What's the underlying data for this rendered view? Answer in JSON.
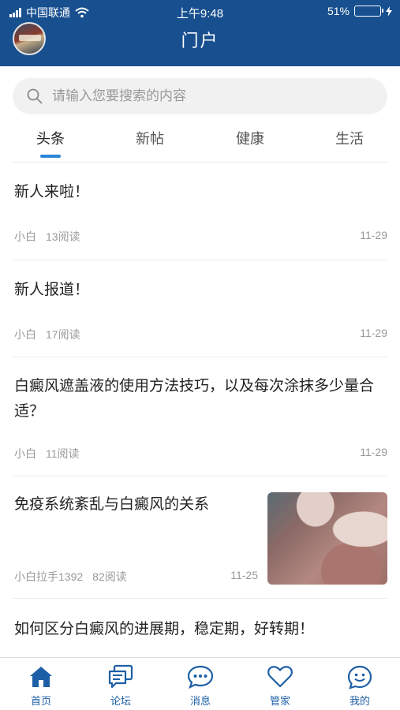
{
  "status_bar": {
    "carrier": "中国联通",
    "time": "上午9:48",
    "battery": "51%",
    "battery_level": 0.51
  },
  "header": {
    "title": "门户"
  },
  "search": {
    "placeholder": "请输入您要搜索的内容"
  },
  "tabs": [
    {
      "label": "头条",
      "active": true
    },
    {
      "label": "新帖",
      "active": false
    },
    {
      "label": "健康",
      "active": false
    },
    {
      "label": "生活",
      "active": false
    }
  ],
  "articles": [
    {
      "title": "新人来啦！",
      "author": "小白",
      "reads": "13阅读",
      "date": "11-29"
    },
    {
      "title": "新人报道！",
      "author": "小白",
      "reads": "17阅读",
      "date": "11-29"
    },
    {
      "title": "白癜风遮盖液的使用方法技巧，以及每次涂抹多少量合适？",
      "author": "小白",
      "reads": "11阅读",
      "date": "11-29"
    },
    {
      "title": "免疫系统紊乱与白癜风的关系",
      "author": "小白拉手1392",
      "reads": "82阅读",
      "date": "11-25",
      "thumbnail": "skin-photo"
    },
    {
      "title": "如何区分白癜风的进展期，稳定期，好转期！"
    }
  ],
  "tabbar": [
    {
      "label": "首页",
      "icon": "home-icon"
    },
    {
      "label": "论坛",
      "icon": "forum-icon"
    },
    {
      "label": "消息",
      "icon": "message-icon"
    },
    {
      "label": "管家",
      "icon": "heart-icon"
    },
    {
      "label": "我的",
      "icon": "profile-icon"
    }
  ],
  "colors": {
    "header_bg": "#174f8f",
    "accent": "#2b86d8",
    "tab_icon": "#1d5fa6"
  }
}
